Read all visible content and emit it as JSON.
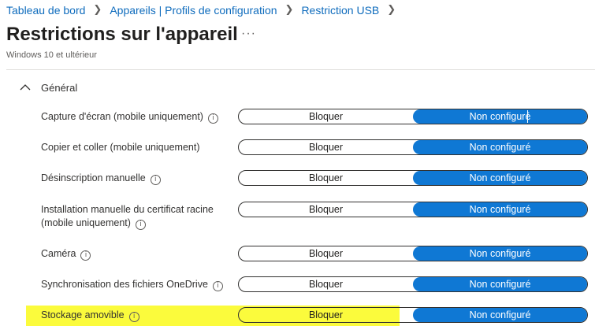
{
  "breadcrumb": [
    "Tableau de bord",
    "Appareils | Profils de configuration",
    "Restriction USB"
  ],
  "page": {
    "title": "Restrictions sur l'appareil",
    "more": "···",
    "subtitle": "Windows 10 et ultérieur"
  },
  "section": {
    "label": "Général",
    "expanded": true
  },
  "settings": [
    {
      "line1": "Capture d'écran (mobile uniquement)",
      "line2": "",
      "block_label": "Bloquer",
      "notconf_label": "Non configuré",
      "selected": "Non configuré"
    },
    {
      "line1": "Copier et coller (mobile uniquement)",
      "line2": "",
      "block_label": "Bloquer",
      "notconf_label": "Non configuré",
      "selected": "Non configuré"
    },
    {
      "line1": "Désinscription manuelle",
      "line2": "",
      "block_label": "Bloquer",
      "notconf_label": "Non configuré",
      "selected": "Non configuré"
    },
    {
      "line1": "Installation manuelle du certificat racine",
      "line2": "(mobile uniquement)",
      "block_label": "Bloquer",
      "notconf_label": "Non configuré",
      "selected": "Non configuré"
    },
    {
      "line1": "Caméra",
      "line2": "",
      "block_label": "Bloquer",
      "notconf_label": "Non configuré",
      "selected": "Non configuré"
    },
    {
      "line1": "Synchronisation des fichiers OneDrive",
      "line2": "",
      "block_label": "Bloquer",
      "notconf_label": "Non configuré",
      "selected": "Non configuré"
    },
    {
      "line1": "Stockage amovible",
      "line2": "",
      "block_label": "Bloquer",
      "notconf_label": "Non configuré",
      "selected": "Non configuré"
    }
  ],
  "colors": {
    "accent": "#0f78d4",
    "link": "#0f6cbd",
    "highlight": "#fbfb3c"
  }
}
